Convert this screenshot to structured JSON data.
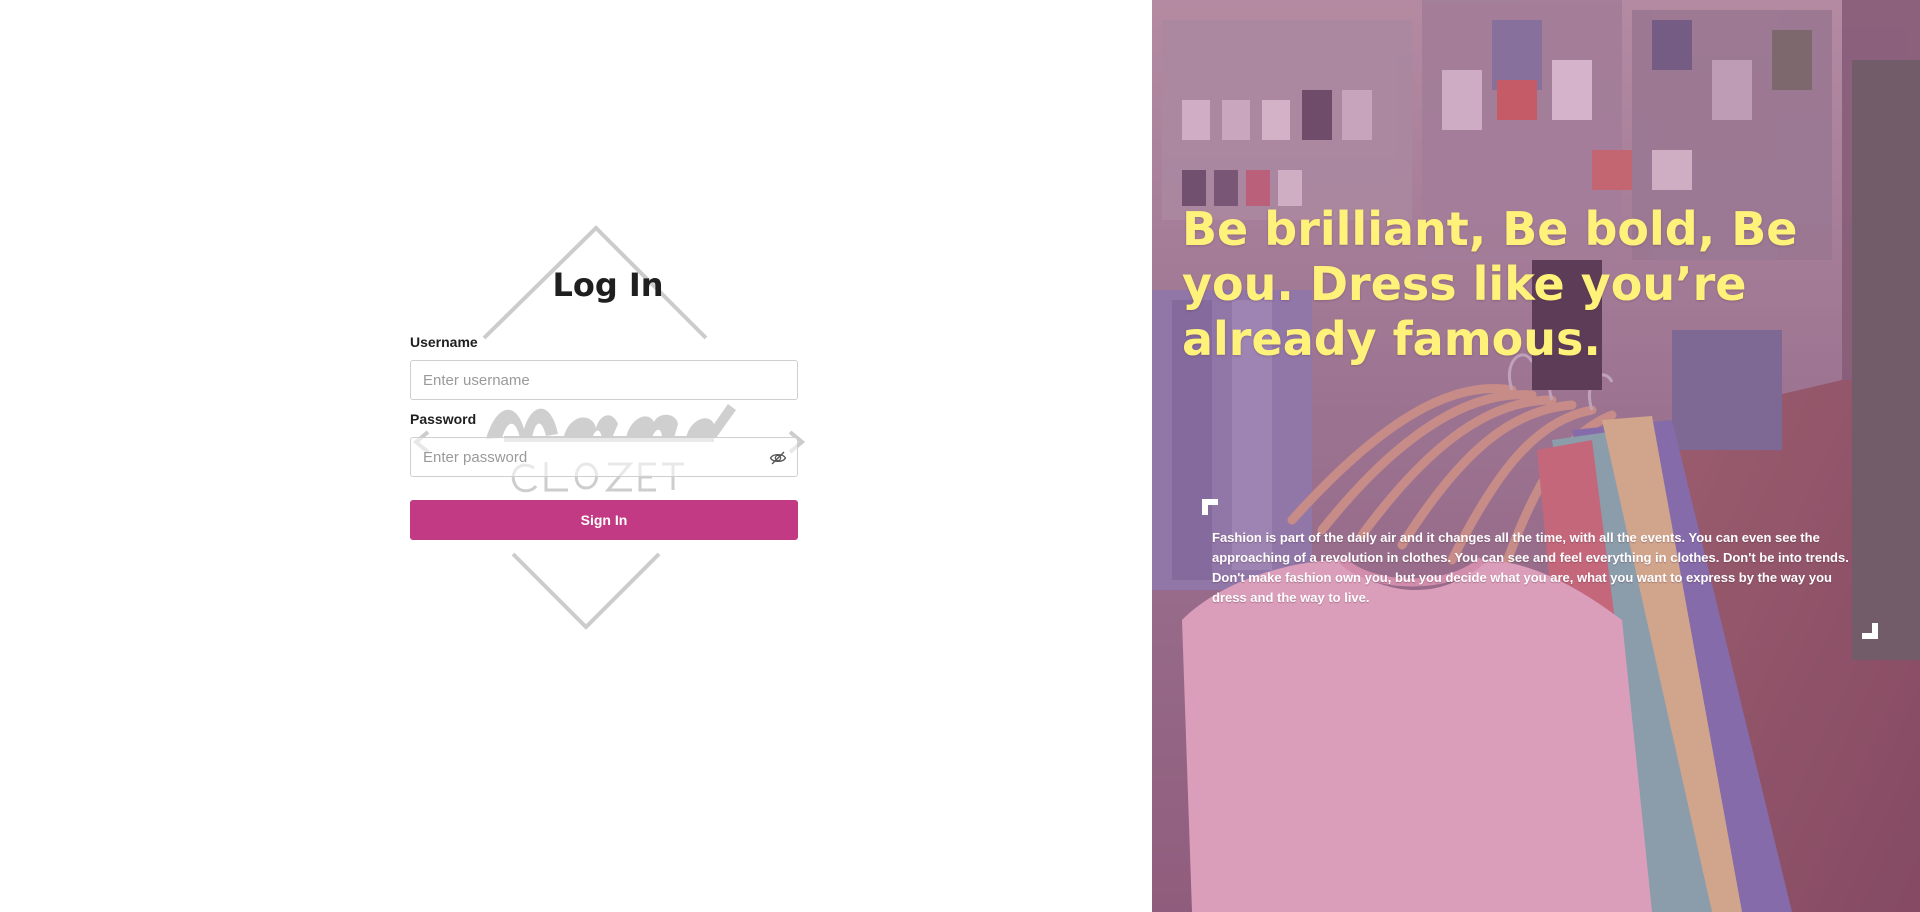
{
  "login": {
    "title": "Log In",
    "username_label": "Username",
    "username_placeholder": "Enter username",
    "username_value": "",
    "password_label": "Password",
    "password_placeholder": "Enter password",
    "password_value": "",
    "password_toggle_icon": "eye-slash-icon",
    "signin_label": "Sign In",
    "signin_color": "#c23a83"
  },
  "brand": {
    "logo_name": "Marwin Clozet",
    "logo_icon": "diamond-logo-icon"
  },
  "hero": {
    "headline": "Be brilliant, Be bold, Be you. Dress like you’re already famous.",
    "headline_color": "#fff27a",
    "quote": "Fashion is part of the daily air and it changes all the time, with all the events. You can even see the approaching of a revolution in clothes. You can see and feel everything in clothes. Don't be into trends. Don't make fashion own you, but you decide what you are, what you want to express by the way you dress and the way to live.",
    "quote_open_icon": "corner-bracket-open-icon",
    "quote_close_icon": "corner-bracket-close-icon",
    "overlay_color": "#b06096"
  }
}
